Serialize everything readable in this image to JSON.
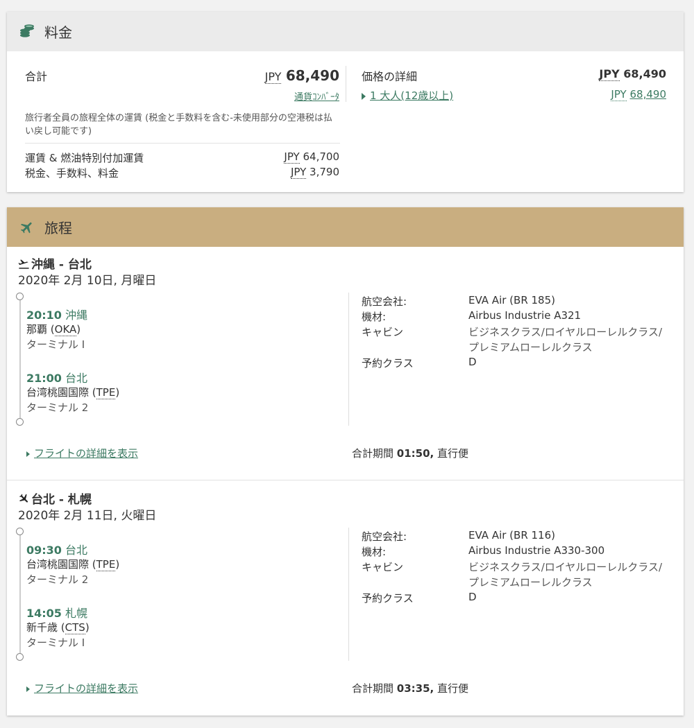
{
  "fare": {
    "title": "料金",
    "total_label": "合計",
    "currency": "JPY",
    "total_amount": "68,490",
    "converter_link": "通貨ｺﾝﾊﾞｰﾀ",
    "note": "旅行者全員の旅程全体の運賃 (税金と手数料を含む-未使用部分の空港税は払い戻し可能です)",
    "note_line1": "旅行者全員の旅程全体の運賃 (税金と手数料を含む-未使用部分の空港税は払",
    "note_line2": "い戻し可能です)",
    "fare_label": "運賃 & 燃油特別付加運賃",
    "fare_amount": "64,700",
    "tax_label": "税金、手数料、料金",
    "tax_amount": "3,790",
    "price_detail_label": "価格の詳細",
    "price_detail_amount": "68,490",
    "passenger_link": "1 大人(12歳以上)",
    "passenger_amount": "68,490"
  },
  "itinerary": {
    "title": "旅程",
    "segments": [
      {
        "route_from": "沖縄",
        "route_sep": " - ",
        "route_to": "台北",
        "date": "2020年 2月 10日, 月曜日",
        "dep_time": "20:10",
        "dep_city": "沖縄",
        "dep_airport": "那覇",
        "dep_code": "OKA",
        "dep_terminal": "ターミナル I",
        "arr_time": "21:00",
        "arr_city": "台北",
        "arr_airport": "台湾桃園国際",
        "arr_code": "TPE",
        "arr_terminal": "ターミナル 2",
        "airline_label": "航空会社:",
        "airline": "EVA Air (BR 185)",
        "aircraft_label": "機材:",
        "aircraft": "Airbus Industrie A321",
        "cabin_label": "キャビン",
        "cabin_line1": "ビジネスクラス/ロイヤルローレルクラス/",
        "cabin_line2": "プレミアムローレルクラス",
        "booking_label": "予約クラス",
        "booking_class": "D",
        "details_link": "フライトの詳細を表示",
        "duration_label": "合計期間",
        "duration": "01:50,",
        "flight_type": "直行便"
      },
      {
        "route_from": "台北",
        "route_sep": " - ",
        "route_to": "札幌",
        "date": "2020年 2月 11日, 火曜日",
        "dep_time": "09:30",
        "dep_city": "台北",
        "dep_airport": "台湾桃園国際",
        "dep_code": "TPE",
        "dep_terminal": "ターミナル 2",
        "arr_time": "14:05",
        "arr_city": "札幌",
        "arr_airport": "新千歳",
        "arr_code": "CTS",
        "arr_terminal": "ターミナル I",
        "airline_label": "航空会社:",
        "airline": "EVA Air (BR 116)",
        "aircraft_label": "機材:",
        "aircraft": "Airbus Industrie A330-300",
        "cabin_label": "キャビン",
        "cabin_line1": "ビジネスクラス/ロイヤルローレルクラス/",
        "cabin_line2": "プレミアムローレルクラス",
        "booking_label": "予約クラス",
        "booking_class": "D",
        "details_link": "フライトの詳細を表示",
        "duration_label": "合計期間",
        "duration": "03:35,",
        "flight_type": "直行便"
      }
    ]
  },
  "icons": {
    "fare": "coins-icon",
    "itinerary": "airplane-icon",
    "departure": "plane-departure-icon",
    "arrival": "plane-arrival-icon"
  },
  "colors": {
    "accent_green": "#3c7a62",
    "itinerary_header": "#c9ae80",
    "fare_header": "#ebebeb"
  }
}
